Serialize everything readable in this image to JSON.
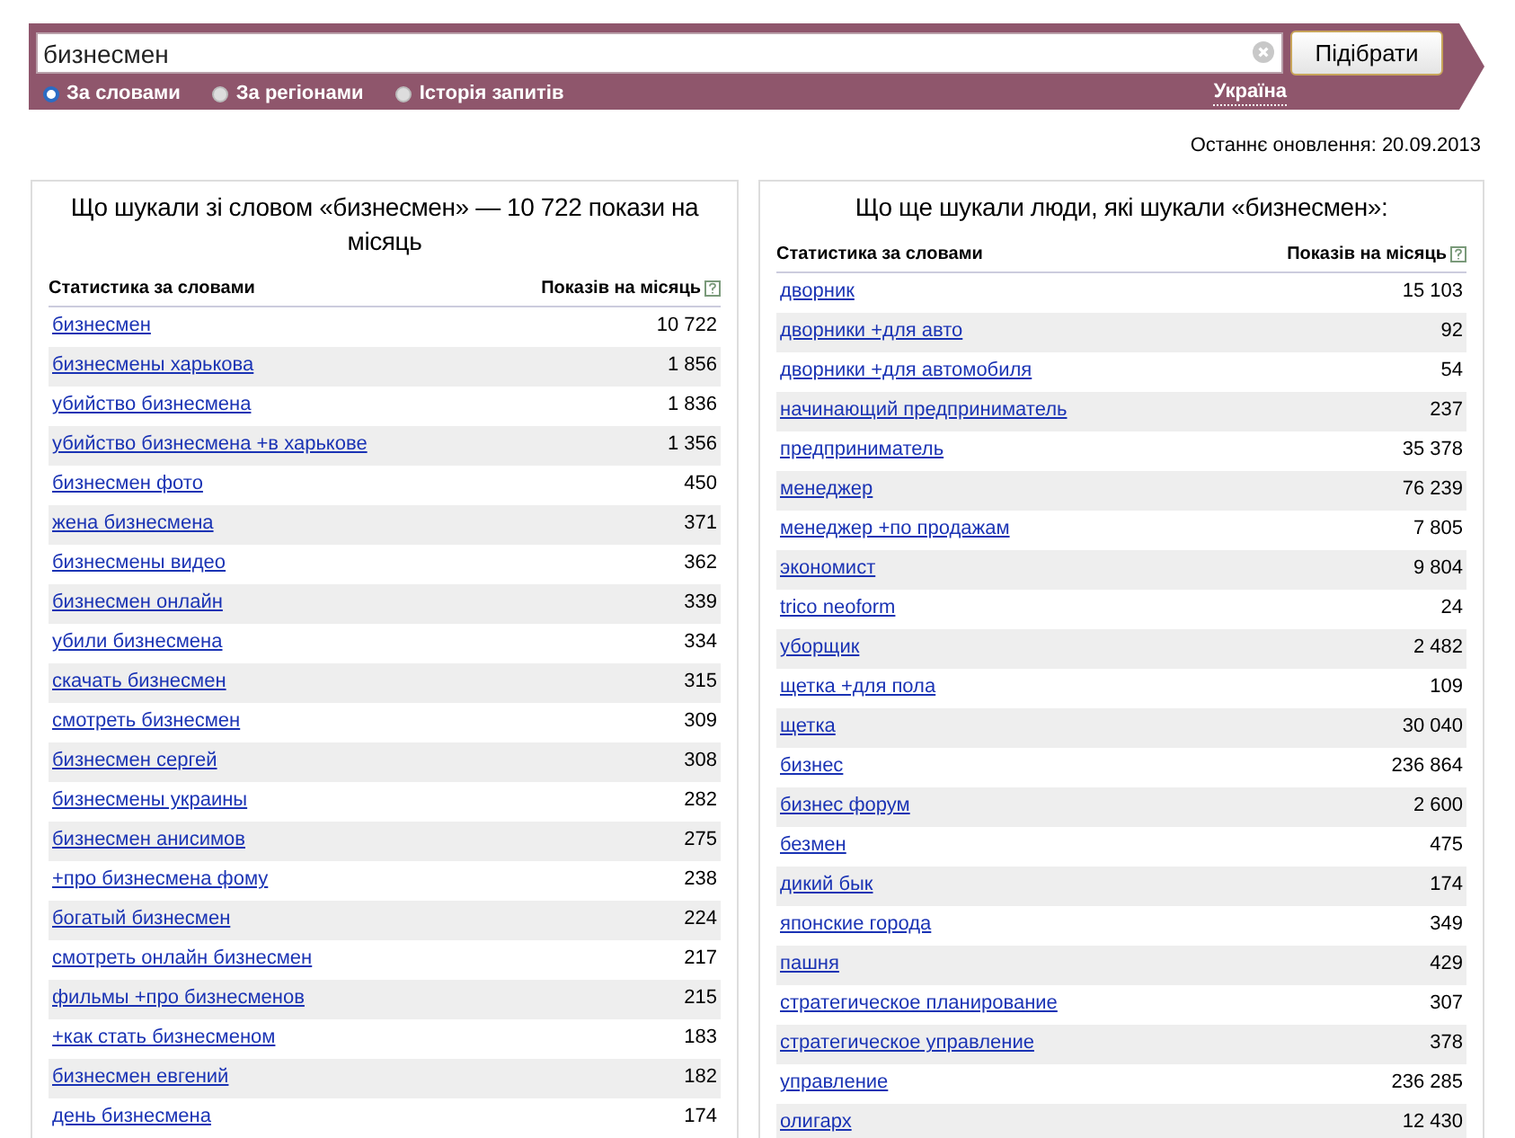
{
  "search": {
    "value": "бизнесмен",
    "button": "Підібрати",
    "modes": [
      {
        "label": "За словами",
        "selected": true
      },
      {
        "label": "За регіонами",
        "selected": false
      },
      {
        "label": "Історія запитів",
        "selected": false
      }
    ],
    "region": "Україна"
  },
  "last_update": "Останнє оновлення: 20.09.2013",
  "panels": [
    {
      "title": "Що шукали зі словом «бизнесмен» — 10 722 покази на місяць",
      "columns": [
        "Статистика за словами",
        "Показів на місяць"
      ],
      "rows": [
        {
          "phrase": "бизнесмен",
          "count": "10 722"
        },
        {
          "phrase": "бизнесмены харькова",
          "count": "1 856"
        },
        {
          "phrase": "убийство бизнесмена",
          "count": "1 836"
        },
        {
          "phrase": "убийство бизнесмена +в харькове",
          "count": "1 356"
        },
        {
          "phrase": "бизнесмен фото",
          "count": "450"
        },
        {
          "phrase": "жена бизнесмена",
          "count": "371"
        },
        {
          "phrase": "бизнесмены видео",
          "count": "362"
        },
        {
          "phrase": "бизнесмен онлайн",
          "count": "339"
        },
        {
          "phrase": "убили бизнесмена",
          "count": "334"
        },
        {
          "phrase": "скачать бизнесмен",
          "count": "315"
        },
        {
          "phrase": "смотреть бизнесмен",
          "count": "309"
        },
        {
          "phrase": "бизнесмен сергей",
          "count": "308"
        },
        {
          "phrase": "бизнесмены украины",
          "count": "282"
        },
        {
          "phrase": "бизнесмен анисимов",
          "count": "275"
        },
        {
          "phrase": "+про бизнесмена фому",
          "count": "238"
        },
        {
          "phrase": "богатый бизнесмен",
          "count": "224"
        },
        {
          "phrase": "смотреть онлайн бизнесмен",
          "count": "217"
        },
        {
          "phrase": "фильмы +про бизнесменов",
          "count": "215"
        },
        {
          "phrase": "+как стать бизнесменом",
          "count": "183"
        },
        {
          "phrase": "бизнесмен евгений",
          "count": "182"
        },
        {
          "phrase": "день бизнесмена",
          "count": "174"
        }
      ]
    },
    {
      "title": "Що ще шукали люди, які шукали «бизнесмен»:",
      "columns": [
        "Статистика за словами",
        "Показів на місяць"
      ],
      "rows": [
        {
          "phrase": "дворник",
          "count": "15 103"
        },
        {
          "phrase": "дворники +для авто",
          "count": "92"
        },
        {
          "phrase": "дворники +для автомобиля",
          "count": "54"
        },
        {
          "phrase": "начинающий предприниматель",
          "count": "237"
        },
        {
          "phrase": "предприниматель",
          "count": "35 378"
        },
        {
          "phrase": "менеджер",
          "count": "76 239"
        },
        {
          "phrase": "менеджер +по продажам",
          "count": "7 805"
        },
        {
          "phrase": "экономист",
          "count": "9 804"
        },
        {
          "phrase": "trico neoform",
          "count": "24"
        },
        {
          "phrase": "уборщик",
          "count": "2 482"
        },
        {
          "phrase": "щетка +для пола",
          "count": "109"
        },
        {
          "phrase": "щетка",
          "count": "30 040"
        },
        {
          "phrase": "бизнес",
          "count": "236 864"
        },
        {
          "phrase": "бизнес форум",
          "count": "2 600"
        },
        {
          "phrase": "безмен",
          "count": "475"
        },
        {
          "phrase": "дикий бык",
          "count": "174"
        },
        {
          "phrase": "японские города",
          "count": "349"
        },
        {
          "phrase": "пашня",
          "count": "429"
        },
        {
          "phrase": "стратегическое планирование",
          "count": "307"
        },
        {
          "phrase": "стратегическое управление",
          "count": "378"
        },
        {
          "phrase": "управление",
          "count": "236 285"
        },
        {
          "phrase": "олигарх",
          "count": "12 430"
        }
      ]
    }
  ]
}
